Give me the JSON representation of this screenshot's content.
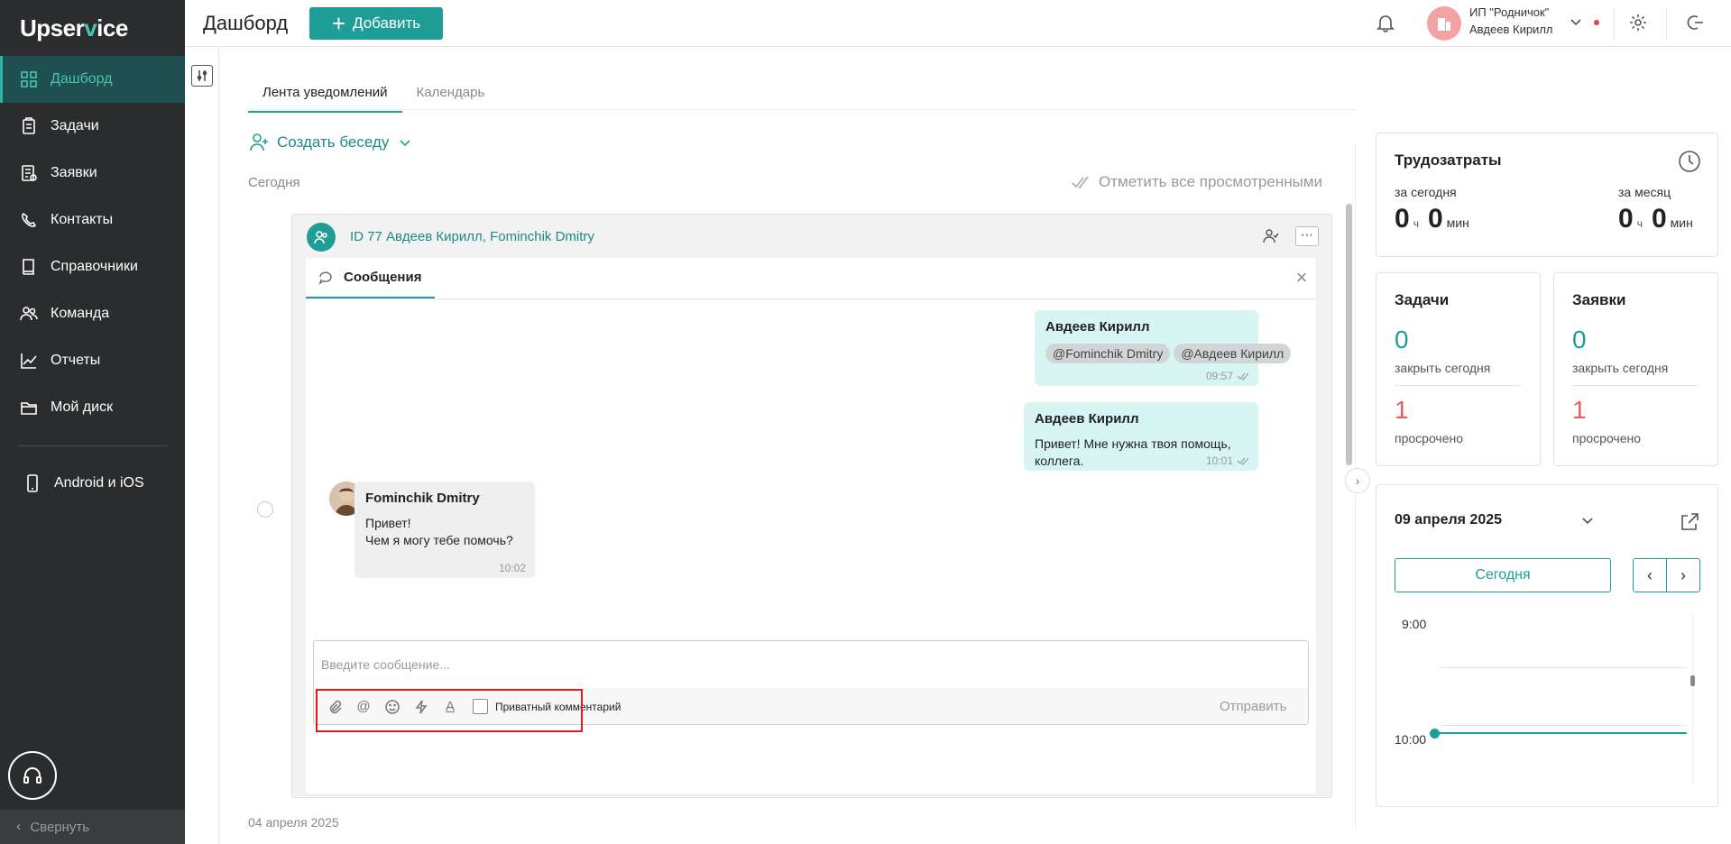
{
  "app": {
    "logo_prefix": "Upser",
    "logo_v": "v",
    "logo_suffix": "ice"
  },
  "sidebar": {
    "items": [
      {
        "label": "Дашборд",
        "icon": "dashboard-icon",
        "active": true
      },
      {
        "label": "Задачи",
        "icon": "tasks-icon"
      },
      {
        "label": "Заявки",
        "icon": "requests-icon"
      },
      {
        "label": "Контакты",
        "icon": "contacts-icon"
      },
      {
        "label": "Справочники",
        "icon": "book-icon"
      },
      {
        "label": "Команда",
        "icon": "team-icon"
      },
      {
        "label": "Отчеты",
        "icon": "chart-icon"
      },
      {
        "label": "Мой диск",
        "icon": "folder-icon"
      }
    ],
    "mobile_label": "Android и iOS",
    "collapse_label": "Свернуть",
    "accent": "#2ab3a6"
  },
  "header": {
    "title": "Дашборд",
    "add_label": "Добавить",
    "org_name": "ИП \"Родничок\"",
    "user_name": "Авдеев Кирилл"
  },
  "tabs": {
    "feed": "Лента уведомлений",
    "calendar": "Календарь"
  },
  "feed": {
    "create_conversation": "Создать беседу",
    "today": "Сегодня",
    "mark_all": "Отметить все просмотренными",
    "card_title": "ID 77 Авдеев Кирилл, Fominchik Dmitry",
    "messages_tab": "Сообщения",
    "messages": [
      {
        "author": "Авдеев Кирилл",
        "mentions": [
          "@Fominchik Dmitry",
          "@Авдеев Кирилл"
        ],
        "time": "09:57"
      },
      {
        "author": "Авдеев Кирилл",
        "text": "Привет! Мне нужна твоя помощь, коллега.",
        "time": "10:01"
      },
      {
        "author": "Fominchik Dmitry",
        "text_line1": "Привет!",
        "text_line2": "Чем я могу тебе помочь?",
        "time": "10:02"
      }
    ],
    "composer_placeholder": "Введите сообщение...",
    "private_comment": "Приватный комментарий",
    "send": "Отправить",
    "earlier_date": "04 апреля 2025"
  },
  "labor": {
    "title": "Трудозатраты",
    "today_label": "за сегодня",
    "month_label": "за месяц",
    "today_h": "0",
    "today_m": "0",
    "month_h": "0",
    "month_m": "0",
    "hours_unit": "ч",
    "min_unit": "мин"
  },
  "tasks_widget": {
    "title": "Задачи",
    "close_today_value": "0",
    "close_today_label": "закрыть сегодня",
    "overdue_value": "1",
    "overdue_label": "просрочено"
  },
  "requests_widget": {
    "title": "Заявки",
    "close_today_value": "0",
    "close_today_label": "закрыть сегодня",
    "overdue_value": "1",
    "overdue_label": "просрочено"
  },
  "calendar": {
    "date": "09 апреля 2025",
    "today_button": "Сегодня",
    "prev": "‹",
    "next": "›",
    "time1": "9:00",
    "time2": "10:00"
  }
}
